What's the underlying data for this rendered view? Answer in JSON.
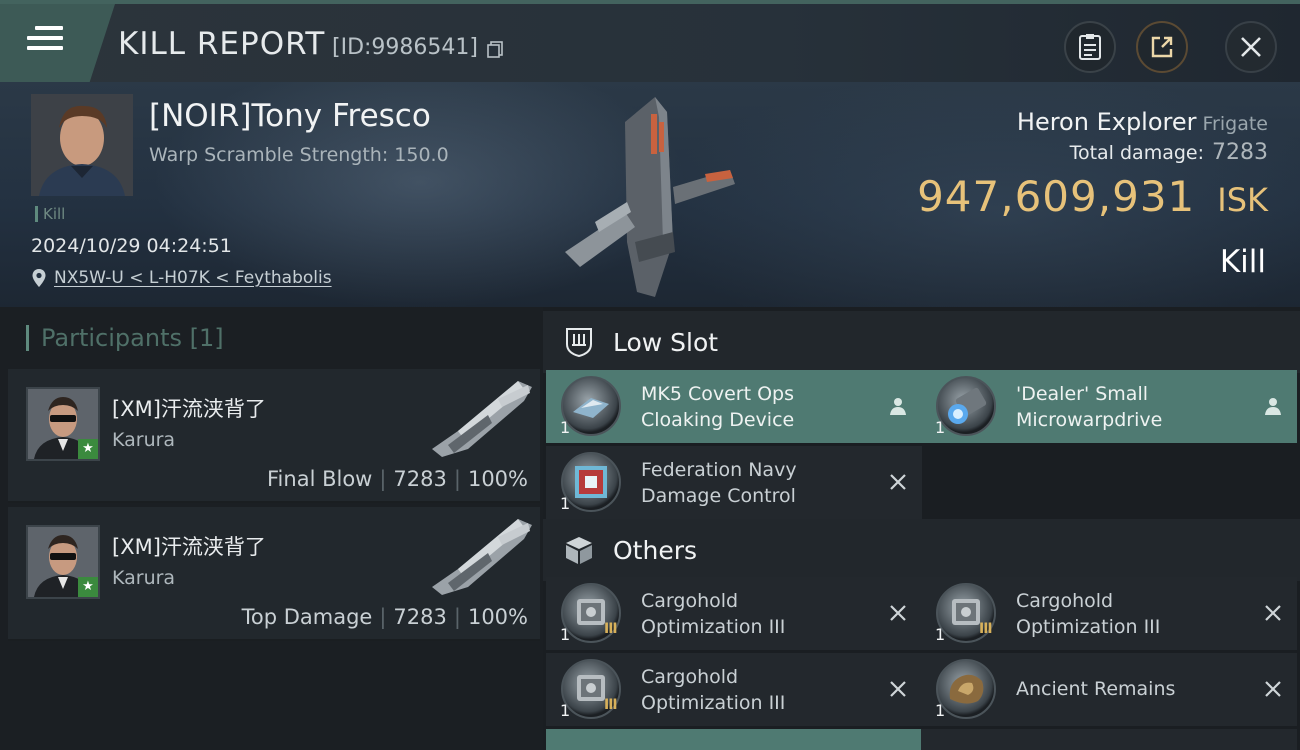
{
  "header": {
    "title": "KILL REPORT",
    "report_id": "[ID:9986541]"
  },
  "victim": {
    "name": "[NOIR]Tony Fresco",
    "warp_scramble": "Warp Scramble Strength: 150.0",
    "tag": "Kill",
    "timestamp": "2024/10/29 04:24:51",
    "location": "NX5W-U < L-H07K < Feythabolis"
  },
  "ship": {
    "name": "Heron Explorer",
    "class": "Frigate",
    "total_damage_label": "Total damage:",
    "total_damage": "7283",
    "isk_value": "947,609,931",
    "isk_unit": "ISK",
    "result": "Kill"
  },
  "participants": {
    "heading": "Participants [1]",
    "rows": [
      {
        "name": "[XM]汗流浃背了",
        "ship": "Karura",
        "role": "Final Blow",
        "damage": "7283",
        "percent": "100%"
      },
      {
        "name": "[XM]汗流浃背了",
        "ship": "Karura",
        "role": "Top Damage",
        "damage": "7283",
        "percent": "100%"
      }
    ]
  },
  "sections": {
    "low_slot": "Low Slot",
    "others": "Others"
  },
  "low_slot_items": [
    {
      "line1": "MK5 Covert Ops",
      "line2": "Cloaking Device",
      "qty": "1",
      "state": "fitted",
      "icon": "cloak-module-icon"
    },
    {
      "line1": "'Dealer' Small",
      "line2": "Microwarpdrive",
      "qty": "1",
      "state": "fitted",
      "icon": "microwarpdrive-icon"
    },
    {
      "line1": "Federation Navy",
      "line2": "Damage Control",
      "qty": "1",
      "state": "destroyed",
      "icon": "damage-control-icon"
    }
  ],
  "other_items": [
    {
      "line1": "Cargohold",
      "line2": "Optimization III",
      "qty": "1",
      "tier": "III",
      "state": "destroyed"
    },
    {
      "line1": "Cargohold",
      "line2": "Optimization III",
      "qty": "1",
      "tier": "III",
      "state": "destroyed"
    },
    {
      "line1": "Cargohold",
      "line2": "Optimization III",
      "qty": "1",
      "tier": "III",
      "state": "destroyed"
    },
    {
      "line1": "Ancient Remains",
      "line2": "",
      "qty": "1",
      "tier": "",
      "state": "destroyed"
    }
  ],
  "colors": {
    "accent_teal": "#4f7a72",
    "isk_gold": "#e7c27a",
    "tier_gold": "#d8b15b"
  }
}
